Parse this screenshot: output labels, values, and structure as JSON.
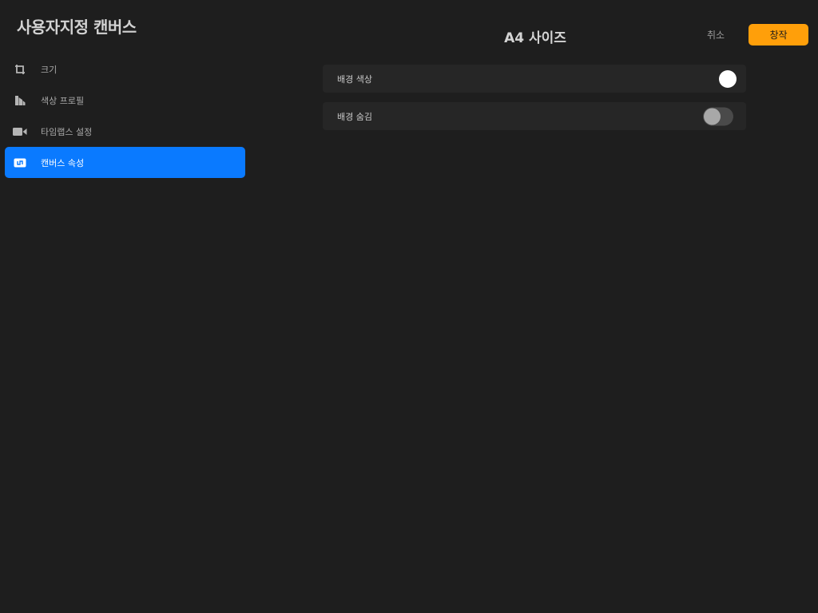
{
  "sidebar": {
    "title": "사용자지정 캔버스",
    "items": [
      {
        "label": "크기",
        "icon": "crop-icon",
        "active": false
      },
      {
        "label": "색상 프로필",
        "icon": "color-profile-icon",
        "active": false
      },
      {
        "label": "타임랩스 설정",
        "icon": "video-camera-icon",
        "active": false
      },
      {
        "label": "캔버스 속성",
        "icon": "canvas-properties-icon",
        "active": true
      }
    ]
  },
  "header": {
    "title": "A4 사이즈",
    "cancel_label": "취소",
    "create_label": "창작"
  },
  "settings": {
    "background_color": {
      "label": "배경 색상",
      "value": "#ffffff"
    },
    "background_hidden": {
      "label": "배경 숨김",
      "enabled": false
    }
  },
  "colors": {
    "accent_blue": "#0a7aff",
    "create_orange": "#ff9f0a",
    "background": "#1e1e1e"
  }
}
